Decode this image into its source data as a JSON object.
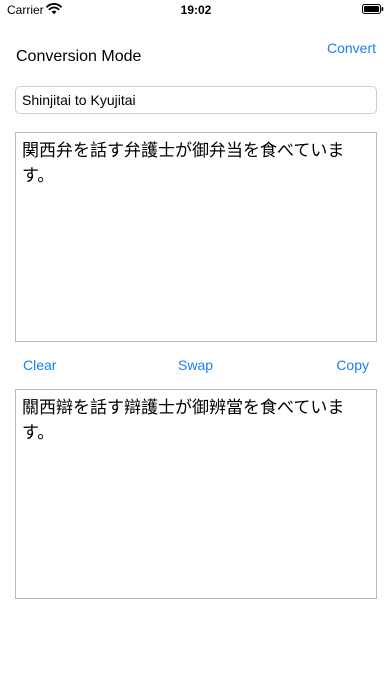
{
  "status": {
    "carrier": "Carrier",
    "time": "19:02"
  },
  "header": {
    "mode_label": "Conversion Mode",
    "convert_label": "Convert"
  },
  "mode_selector": {
    "value": "Shinjitai to Kyujitai"
  },
  "input_text": "関西弁を話す弁護士が御弁当を食べています。",
  "actions": {
    "clear_label": "Clear",
    "swap_label": "Swap",
    "copy_label": "Copy"
  },
  "output_text": "關西辯を話す辯護士が御辨當を食べています。",
  "colors": {
    "accent": "#1a7ff0"
  },
  "icons": [
    "wifi-icon",
    "battery-icon"
  ]
}
